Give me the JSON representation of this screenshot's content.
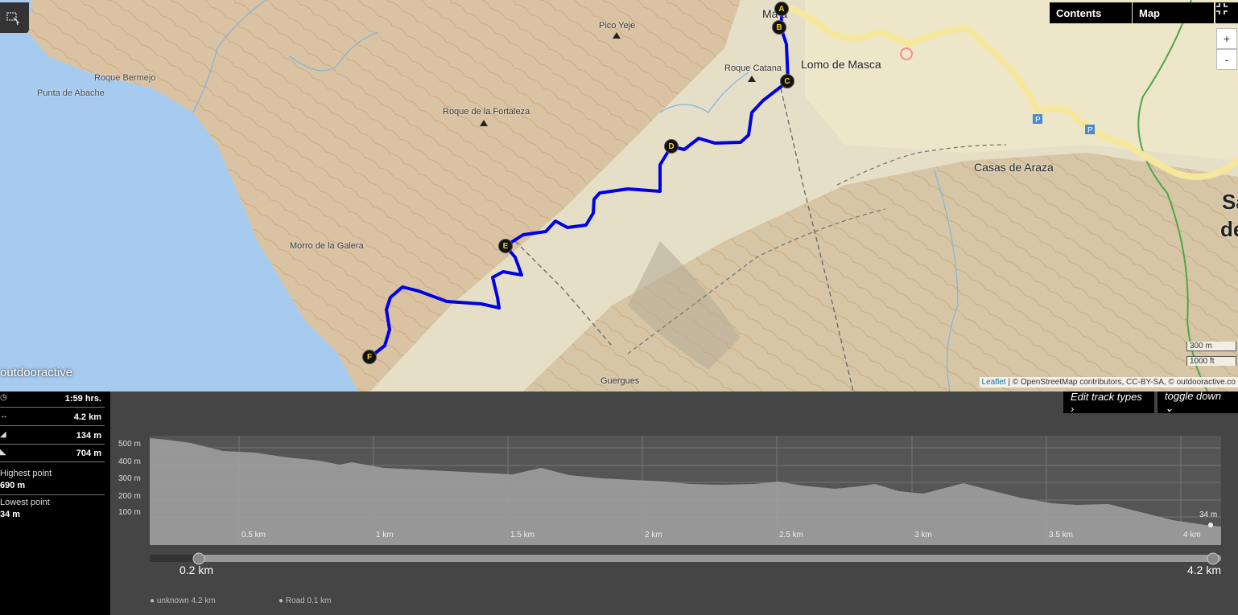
{
  "map": {
    "places": [
      {
        "id": "punta-de-abache",
        "text": "Punta de Abache"
      },
      {
        "id": "roque-bermejo",
        "text": "Roque Bermejo"
      },
      {
        "id": "roque-de-la-fortaleza",
        "text": "Roque de la Fortaleza"
      },
      {
        "id": "pico-yeje",
        "text": "Pico Yeje"
      },
      {
        "id": "roque-catana",
        "text": "Roque Catana"
      },
      {
        "id": "lomo-de-masca",
        "text": "Lomo de Masca"
      },
      {
        "id": "masca",
        "text": "Ma  a"
      },
      {
        "id": "casas-de-araza",
        "text": "Casas de Araza"
      },
      {
        "id": "morro-de-la-galera",
        "text": "Morro de la Galera"
      },
      {
        "id": "guergues",
        "text": "Guergues"
      },
      {
        "id": "sa",
        "text": "Sa"
      },
      {
        "id": "de",
        "text": "de"
      }
    ],
    "waypoints": [
      "A",
      "B",
      "C",
      "D",
      "E",
      "F"
    ],
    "brand": "outdooractive",
    "scale_m": "300 m",
    "scale_ft": "1000 ft",
    "attribution_leaflet": "Leaflet",
    "attribution_rest": " | © OpenStreetMap contributors, CC-BY-SA, © outdooractive.co",
    "zoom_in": "+",
    "zoom_out": "-",
    "route_color": "#0000e6"
  },
  "toolbar": {
    "contents_label": "Contents",
    "map_label": "Map"
  },
  "stats": {
    "duration": "1:59 hrs.",
    "distance": "4.2 km",
    "ascent": "134 m",
    "descent": "704 m",
    "highest_label": "Highest point",
    "highest_value": "690 m",
    "lowest_label": "Lowest point",
    "lowest_value": "34 m"
  },
  "profile": {
    "edit_label": "Edit track types ›",
    "toggle_label": "toggle down ⌄",
    "y_ticks": [
      "500 m",
      "400 m",
      "300 m",
      "200 m",
      "100 m"
    ],
    "x_ticks": [
      "0.5 km",
      "1 km",
      "1.5 km",
      "2 km",
      "2.5 km",
      "3 km",
      "3.5 km",
      "4 km"
    ],
    "end_marker": "34 m",
    "range_start": "0.2 km",
    "range_end": "4.2 km",
    "legend": [
      {
        "text": "● unknown 4.2 km"
      },
      {
        "text": "● Road 0.1 km"
      }
    ]
  }
}
